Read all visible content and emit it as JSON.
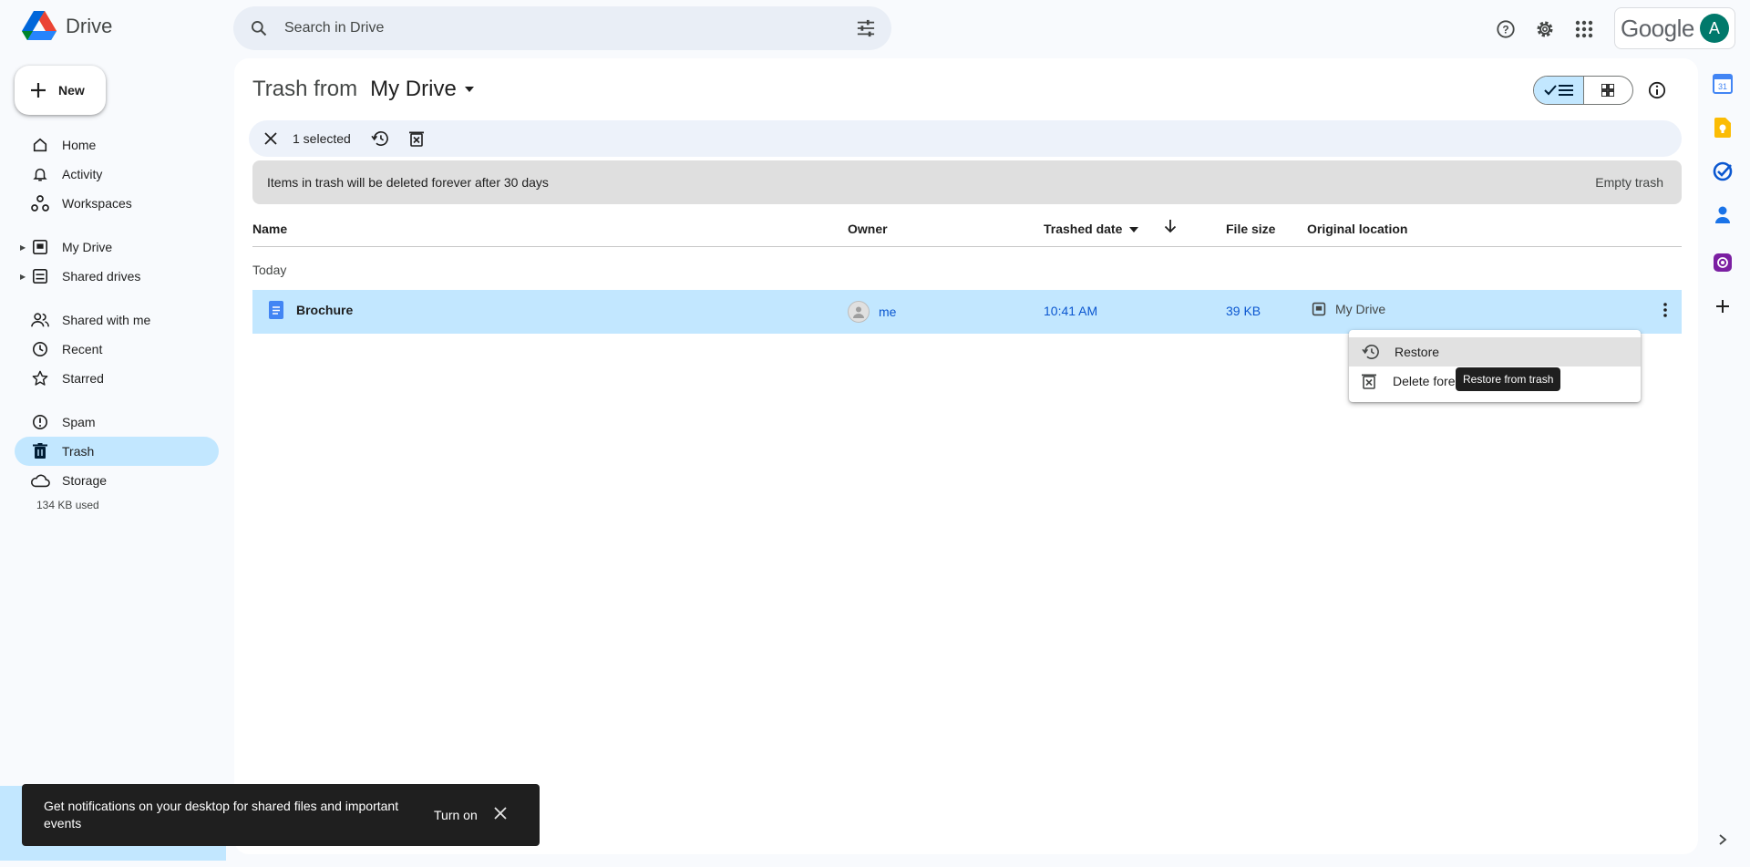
{
  "app": {
    "name": "Drive"
  },
  "search": {
    "placeholder": "Search in Drive"
  },
  "header": {
    "google_label": "Google",
    "avatar_letter": "A"
  },
  "sidebar": {
    "new_label": "New",
    "items": [
      {
        "label": "Home"
      },
      {
        "label": "Activity"
      },
      {
        "label": "Workspaces"
      },
      {
        "label": "My Drive"
      },
      {
        "label": "Shared drives"
      },
      {
        "label": "Shared with me"
      },
      {
        "label": "Recent"
      },
      {
        "label": "Starred"
      },
      {
        "label": "Spam"
      },
      {
        "label": "Trash"
      },
      {
        "label": "Storage"
      }
    ],
    "storage_used": "134 KB used"
  },
  "main": {
    "title_prefix": "Trash from",
    "title_location": "My Drive",
    "selection_count": "1 selected",
    "banner_text": "Items in trash will be deleted forever after 30 days",
    "empty_trash_label": "Empty trash",
    "columns": {
      "name": "Name",
      "owner": "Owner",
      "trashed_date": "Trashed date",
      "file_size": "File size",
      "original_location": "Original location"
    },
    "group_label": "Today",
    "rows": [
      {
        "name": "Brochure",
        "owner": "me",
        "trashed_date": "10:41 AM",
        "file_size": "39 KB",
        "original_location": "My Drive"
      }
    ]
  },
  "context_menu": {
    "items": [
      {
        "label": "Restore"
      },
      {
        "label": "Delete fore"
      }
    ],
    "tooltip": "Restore from trash"
  },
  "snackbar": {
    "message": "Get notifications on your desktop for shared files and important events",
    "action_label": "Turn on"
  },
  "colors": {
    "selected": "#c2e7ff",
    "accent": "#0b57d0",
    "doc_blue": "#4285f4"
  }
}
